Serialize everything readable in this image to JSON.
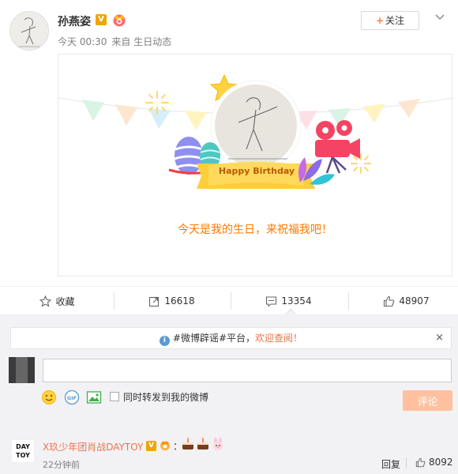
{
  "post": {
    "author": "孙燕姿",
    "time": "今天 00:30",
    "source": "来自 生日动态",
    "follow_label": "关注",
    "birthday_text": "今天是我的生日，来祝福我吧！",
    "ribbon_text": "Happy Birthday"
  },
  "actions": {
    "favorite_label": "收藏",
    "repost_count": "16618",
    "comment_count": "13354",
    "like_count": "48907"
  },
  "comments": {
    "notice_prefix": "#微博辟谣#平台，",
    "notice_link": "欢迎查阅！",
    "input_value": "",
    "forward_label": "同时转发到我的微博",
    "submit_label": "评论",
    "first": {
      "avatar_text_top": "DAY",
      "avatar_text_bottom": "TOY",
      "name": "X玖少年团肖战DAYTOY",
      "colon": "：",
      "time": "22分钟前",
      "reply_label": "回复",
      "like_count": "8092"
    }
  },
  "icons": {
    "verified": "verified-v-icon",
    "member": "crown-icon",
    "emoji": "emoji-icon",
    "gif": "gif-icon",
    "image": "image-icon"
  },
  "colors": {
    "accent": "#ff8140",
    "link": "#eb7350",
    "birthday_text": "#ff7a00",
    "submit_disabled": "#ffc09f"
  }
}
